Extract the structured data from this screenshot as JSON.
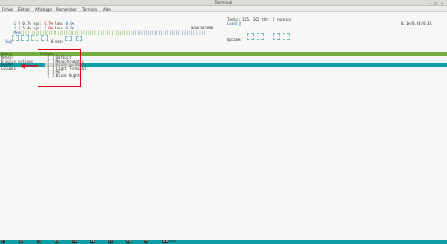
{
  "window": {
    "title": "Terminal",
    "buttons": {
      "minimize": "–",
      "maximize": "□",
      "close": "×"
    }
  },
  "menubar": {
    "items": [
      "Fichier",
      "Édition",
      "Affichage",
      "Rechercher",
      "Terminal",
      "Aide"
    ]
  },
  "htop": {
    "cpu1": {
      "index": "1",
      "sys_label": "0.7% sys:",
      "sys_val": "0.7%",
      "low_label": "low:",
      "low_val": "0.0%"
    },
    "cpu2": {
      "index": "2",
      "sys_label": "5.4% sys:",
      "sys_val": "2.0%",
      "low_label": "low:",
      "low_val": "0.0%"
    },
    "mem": {
      "label": "Mem",
      "value": "900/3021MB"
    },
    "swp": {
      "label": "Swp"
    },
    "secs_label": "0 secs",
    "tasks_line": "Tasks: 125, 262 thr; 1 running",
    "load_label": "Load",
    "load_values": "0.16/0.34/0.31",
    "uptime_label": "Uptime:"
  },
  "setup": {
    "header_left": "Setup",
    "header_right": "Colors",
    "categories": [
      "Meters",
      "Display options",
      "Colors",
      "Columns"
    ],
    "selected_category": "Colors",
    "color_schemes": [
      "[ ] Default",
      "[ ] Monochromatic",
      "[ ] Black on White",
      "[ ] Light Terminal",
      "[ ] MC",
      "[ ] Black Night"
    ],
    "selected_scheme": "[ ] Black on White"
  },
  "function_keys": [
    {
      "key": "F1",
      "label": ""
    },
    {
      "key": "F2",
      "label": ""
    },
    {
      "key": "F3",
      "label": ""
    },
    {
      "key": "F4",
      "label": ""
    },
    {
      "key": "F5",
      "label": ""
    },
    {
      "key": "F6",
      "label": ""
    },
    {
      "key": "F7",
      "label": ""
    },
    {
      "key": "F8",
      "label": ""
    },
    {
      "key": "F9",
      "label": ""
    },
    {
      "key": "F10",
      "label": "Done"
    }
  ],
  "colors": {
    "menu_green": "#73ad3d",
    "highlight_cyan": "#0d9fa5",
    "annotation_red": "#e0001a"
  }
}
